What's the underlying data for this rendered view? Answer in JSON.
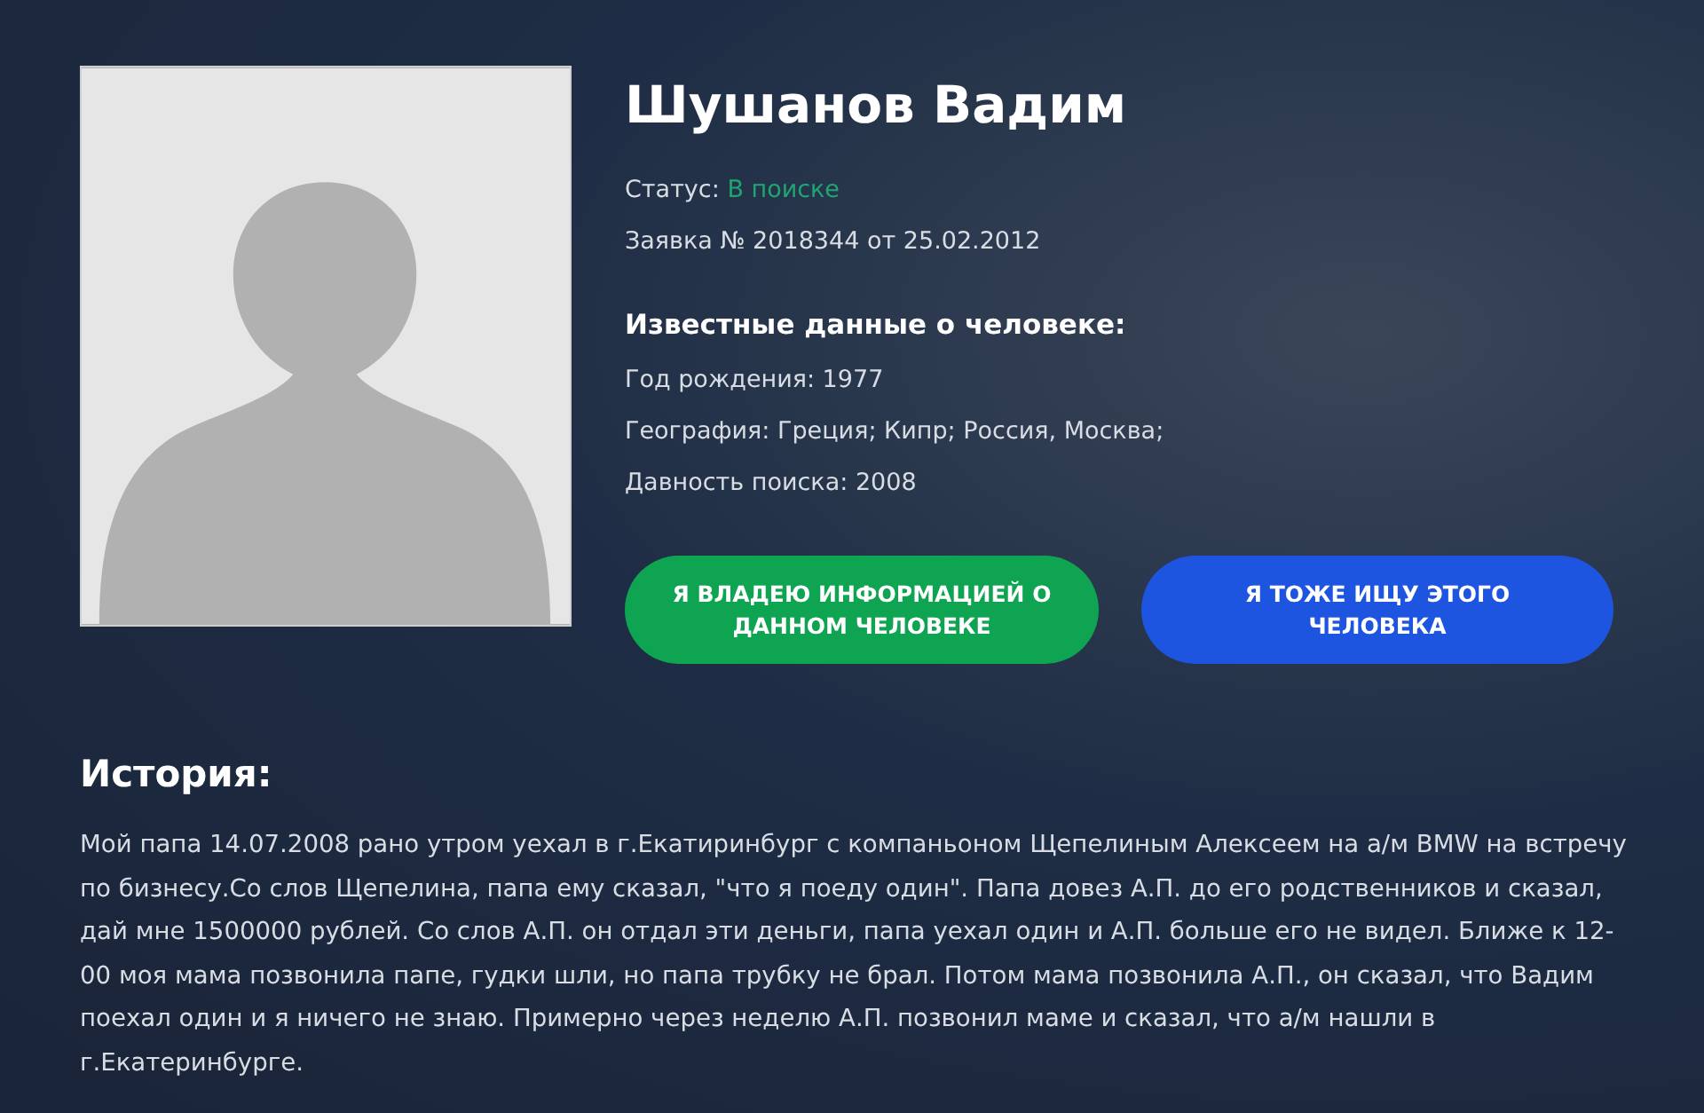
{
  "person": {
    "name": "Шушанов Вадим",
    "photo": {
      "kind": "avatar"
    },
    "status": {
      "label": "Статус:",
      "value": "В поиске"
    },
    "request": "Заявка № 2018344 от 25.02.2012",
    "known_heading": "Известные данные о человеке:",
    "facts": [
      "Год рождения: 1977",
      "География: Греция; Кипр; Россия, Москва;",
      "Давность поиска: 2008"
    ],
    "buttons": [
      {
        "label": "Я ВЛАДЕЮ ИНФОРМАЦИЕЙ О ДАННОМ ЧЕЛОВЕКЕ",
        "color": "#0fa451"
      },
      {
        "label": "Я ТОЖЕ ИЩУ ЭТОГО ЧЕЛОВЕКА",
        "color": "#1d55e0"
      }
    ]
  },
  "history": {
    "heading": "История:",
    "text": "Мой папа 14.07.2008 рано утром уехал в г.Екатиринбург с компаньоном Щепелиным Алексеем на а/м BMW на встречу по бизнесу.Со слов Щепелина, папа ему сказал, \"что я поеду один\". Папа довез А.П. до его родственников и сказал, дай мне 1500000 рублей. Со слов А.П. он отдал эти деньги, папа уехал один и А.П. больше его не видел. Ближе к 12-00 моя мама позвонила папе, гудки шли, но папа трубку не брал. Потом мама позвонила А.П., он сказал, что Вадим поехал один и я ничего не знаю. Примерно через неделю А.П. позвонил маме и сказал, что а/м нашли в г.Екатеринбурге."
  }
}
